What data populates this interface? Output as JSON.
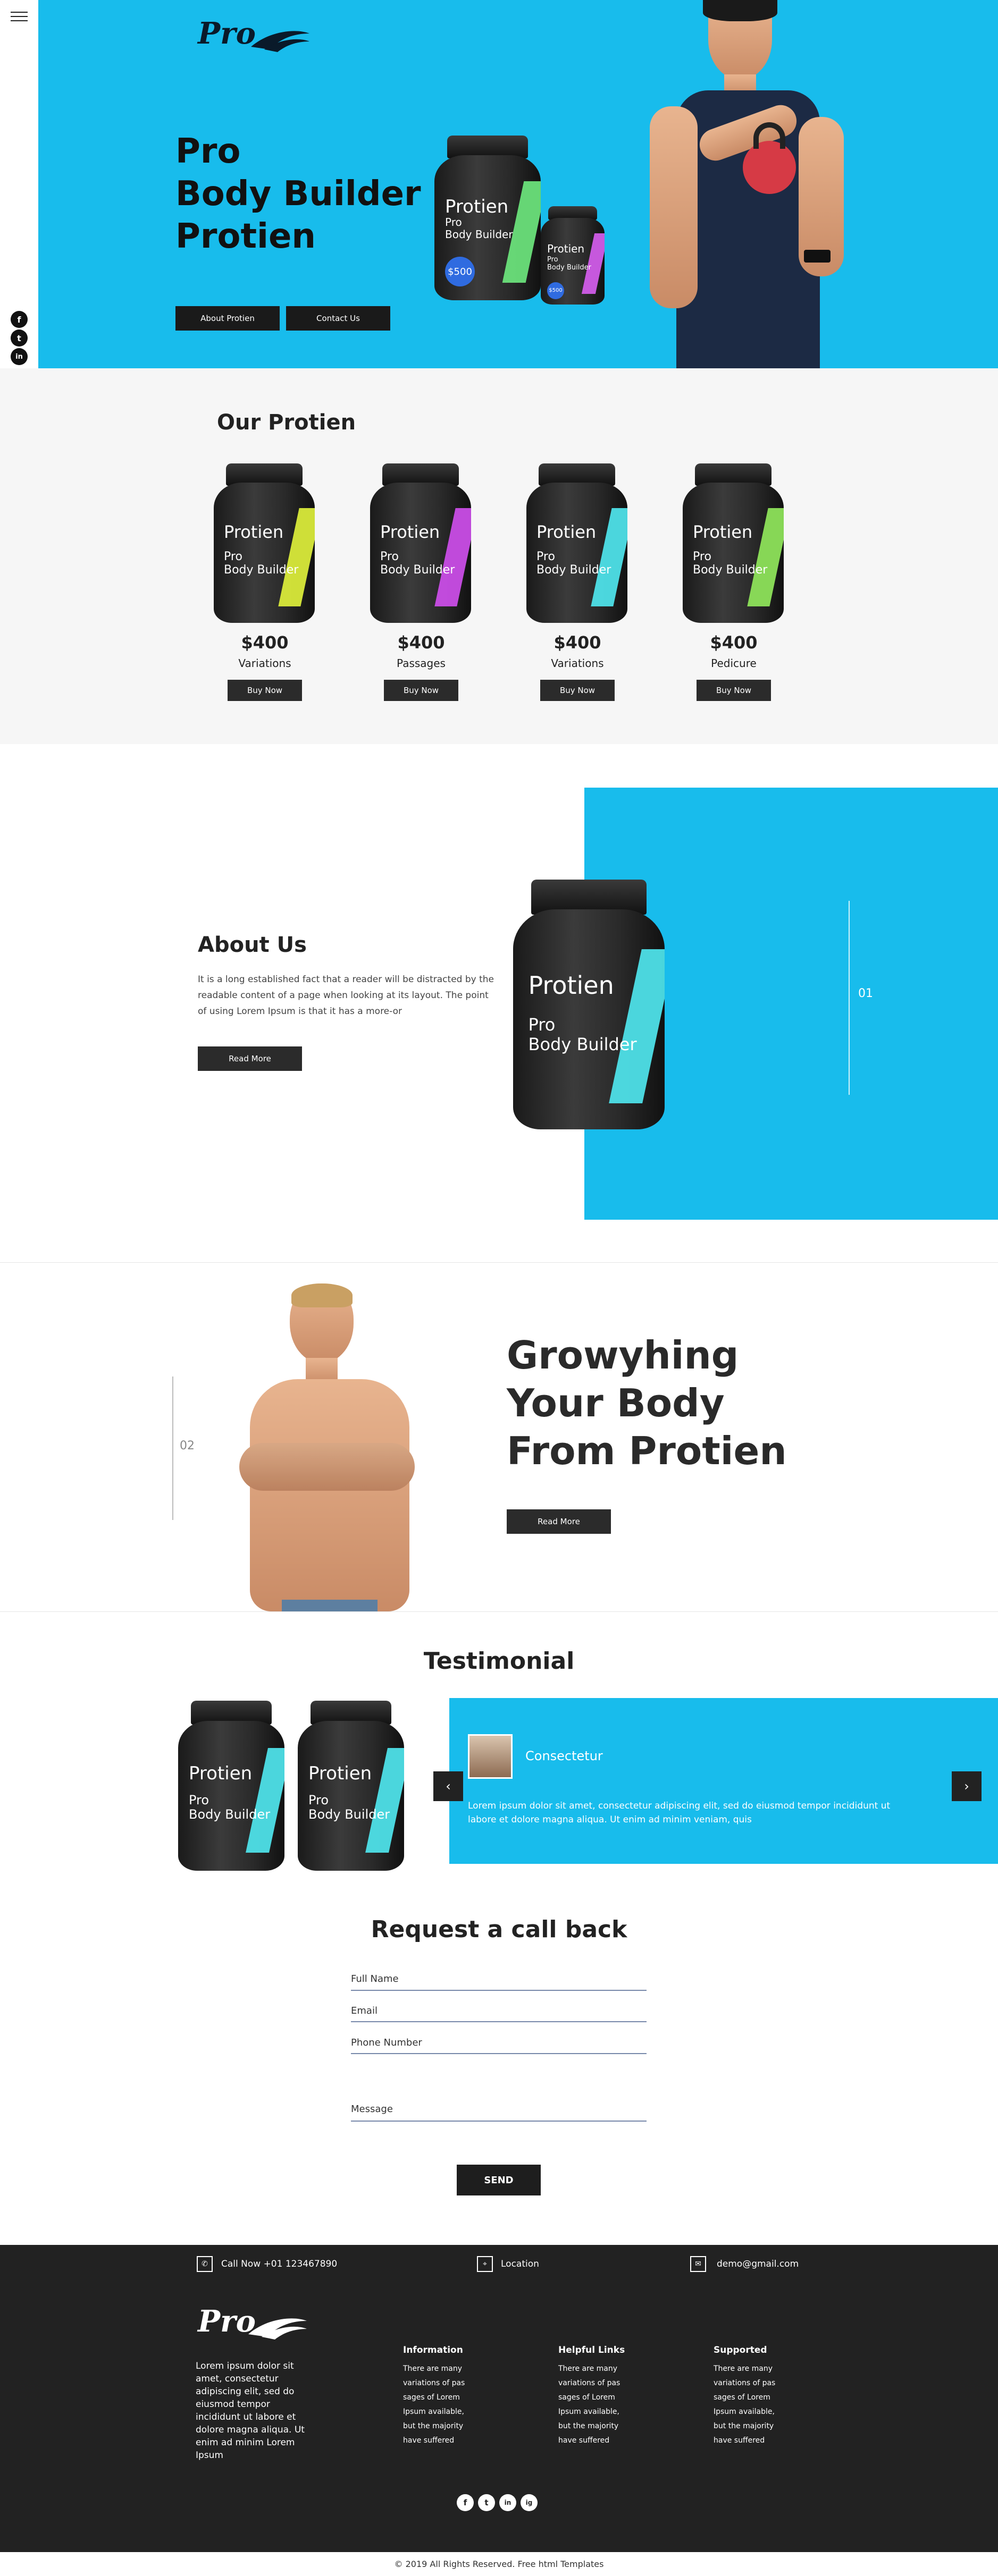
{
  "hero": {
    "logo": "Pro",
    "title_lines": [
      "Pro",
      "Body Builder",
      "Protien"
    ],
    "about_button": "About Protien",
    "contact_button": "Contact Us",
    "jar_brand": "Protien",
    "jar_sub_1": "Pro",
    "jar_sub_2": "Body Builder",
    "jar_price": "$500",
    "jar_price_small": "$500",
    "social": [
      "f",
      "t",
      "in"
    ]
  },
  "our_protein": {
    "title": "Our Protien",
    "products": [
      {
        "price": "$400",
        "name": "Variations",
        "button": "Buy Now",
        "stripe": "#d9ea3a"
      },
      {
        "price": "$400",
        "name": "Passages",
        "button": "Buy Now",
        "stripe": "#c94de6"
      },
      {
        "price": "$400",
        "name": "Variations",
        "button": "Buy Now",
        "stripe": "#4ee0e8"
      },
      {
        "price": "$400",
        "name": "Pedicure",
        "button": "Buy Now",
        "stripe": "#8de25a"
      }
    ],
    "jar_brand": "Protien",
    "jar_sub_1": "Pro",
    "jar_sub_2": "Body Builder"
  },
  "about": {
    "title": "About Us",
    "text": "It is a long established fact that a reader will be distracted by the readable content of a page when looking at its layout. The point of using Lorem Ipsum is that it has a more-or",
    "button": "Read More",
    "number": "01"
  },
  "growing": {
    "title_lines": [
      "Growyhing",
      "Your Body",
      "From Protien"
    ],
    "button": "Read More",
    "number": "02"
  },
  "testimonial": {
    "title": "Testimonial",
    "name": "Consectetur",
    "text": "Lorem ipsum dolor sit amet, consectetur adipiscing elit, sed do eiusmod tempor incididunt ut labore et dolore magna aliqua. Ut enim ad minim veniam, quis",
    "prev": "‹",
    "next": "›"
  },
  "request": {
    "title": "Request a call back",
    "full_name": "Full Name",
    "email": "Email",
    "phone": "Phone Number",
    "message": "Message",
    "send": "SEND"
  },
  "footer": {
    "call": "Call Now +01 123467890",
    "location": "Location",
    "email": "demo@gmail.com",
    "logo": "Pro",
    "about": "Lorem ipsum dolor sit amet, consectetur adipiscing elit, sed do eiusmod tempor incididunt ut labore et dolore magna aliqua. Ut enim ad minim Lorem Ipsum",
    "columns": [
      {
        "title": "Information",
        "text": "There are many variations of pas sages of Lorem Ipsum available, but the majority have suffered"
      },
      {
        "title": "Helpful Links",
        "text": "There are many variations of pas sages of Lorem Ipsum available, but the majority have suffered"
      },
      {
        "title": "Supported",
        "text": "There are many variations of pas sages of Lorem Ipsum available, but the majority have suffered"
      }
    ],
    "social": [
      "f",
      "t",
      "in",
      "ig"
    ],
    "copyright": "© 2019 All Rights Reserved. Free html Templates"
  },
  "colors": {
    "accent": "#18bcec",
    "dark": "#222222"
  }
}
